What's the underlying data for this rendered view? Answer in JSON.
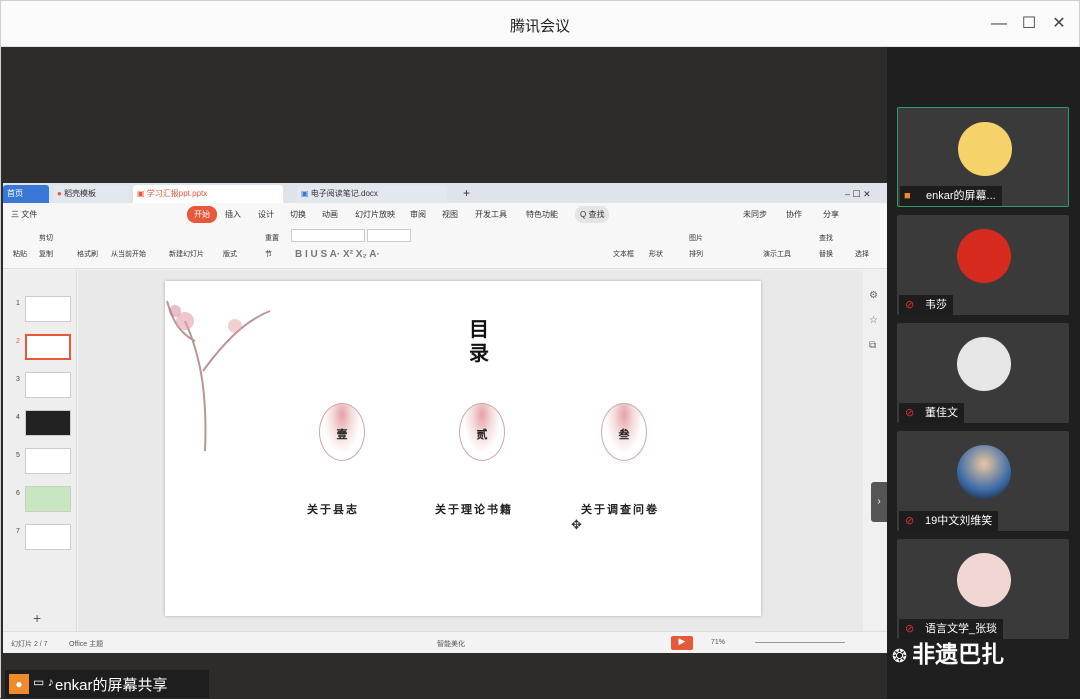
{
  "window": {
    "title": "腾讯会议"
  },
  "share": {
    "label": "enkar的屏幕共享"
  },
  "wps": {
    "tabs": [
      "首页",
      "稻壳模板",
      "学习汇报ppt.pptx",
      "电子阅读笔记.docx"
    ],
    "menu": [
      "三 文件",
      "开始",
      "插入",
      "设计",
      "切换",
      "动画",
      "幻灯片放映",
      "审阅",
      "视图",
      "开发工具",
      "特色功能",
      "Q 查找",
      "未同步",
      "协作",
      "分享"
    ],
    "ribbon": [
      "粘贴",
      "剪切",
      "复制",
      "格式刷",
      "从当前开始",
      "新建幻灯片",
      "版式",
      "重置",
      "节",
      "文本框",
      "形状",
      "图片",
      "排列",
      "演示工具",
      "查找",
      "替换",
      "选择"
    ],
    "slide_nums": [
      "1",
      "2",
      "3",
      "4",
      "5",
      "6",
      "7"
    ],
    "status": {
      "page": "幻灯片 2 / 7",
      "theme": "Office 主题",
      "beautify": "智能美化",
      "zoom": "71%"
    }
  },
  "slide": {
    "title": "目录",
    "items": [
      {
        "num": "壹",
        "label": "关于县志"
      },
      {
        "num": "贰",
        "label": "关于理论书籍"
      },
      {
        "num": "叁",
        "label": "关于调查问卷"
      }
    ]
  },
  "participants": [
    {
      "name": "enkar的屏幕...",
      "active": true
    },
    {
      "name": "韦莎"
    },
    {
      "name": "董佳文"
    },
    {
      "name": "19中文刘维笑"
    },
    {
      "name": "语言文学_张琰"
    }
  ],
  "watermark": "非遗巴扎",
  "colors": {
    "accent_green": "#2c9c6a",
    "wps_orange": "#e8583a",
    "mic_off_red": "#e03030"
  }
}
